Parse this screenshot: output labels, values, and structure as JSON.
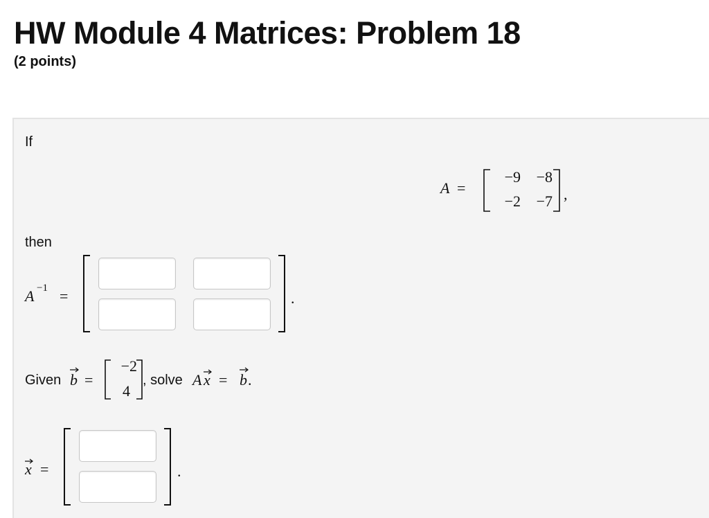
{
  "header": {
    "title": "HW Module 4 Matrices: Problem 18",
    "points": "(2 points)"
  },
  "problem": {
    "intro": "If",
    "matrix_a": {
      "name": "A",
      "rows": [
        [
          "−9",
          "−8"
        ],
        [
          "−2",
          "−7"
        ]
      ],
      "trailing": ","
    },
    "then_text": "then",
    "inverse": {
      "label": "A",
      "superscript": "−1",
      "trailing": "."
    },
    "given_text": "Given",
    "b_vector": {
      "name": "b",
      "values": [
        "−2",
        "4"
      ]
    },
    "solve_text": ", solve",
    "solve_eq": {
      "lhs": "A",
      "x": "x",
      "rhs": "b",
      "trailing": "."
    },
    "x_vector": {
      "label": "x",
      "trailing": "."
    },
    "answers": {
      "inverse_r1c1": "",
      "inverse_r1c2": "",
      "inverse_r2c1": "",
      "inverse_r2c2": "",
      "x_r1": "",
      "x_r2": ""
    }
  }
}
